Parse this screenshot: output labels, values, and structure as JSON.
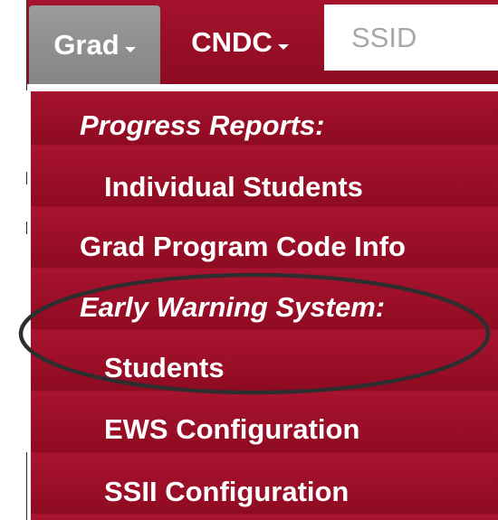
{
  "navbar": {
    "grad_label": "Grad",
    "cndc_label": "CNDC",
    "ssid_placeholder": "SSID",
    "ssid_value": ""
  },
  "grad_menu": {
    "items": [
      {
        "label": "Progress Reports:",
        "kind": "header"
      },
      {
        "label": "Individual Students",
        "kind": "sub"
      },
      {
        "label": "Grad Program Code Info",
        "kind": "top"
      },
      {
        "label": "Early Warning System:",
        "kind": "header"
      },
      {
        "label": "Students",
        "kind": "sub"
      },
      {
        "label": "EWS Configuration",
        "kind": "sub"
      },
      {
        "label": "SSII Configuration",
        "kind": "sub"
      }
    ]
  },
  "annotation": {
    "highlight_color": "#2e2e2e",
    "circled_items": [
      "Early Warning System:",
      "Students"
    ]
  },
  "colors": {
    "menu_background": "#9c0f28",
    "active_tab": "#8f8f8f",
    "text": "#ffffff"
  }
}
